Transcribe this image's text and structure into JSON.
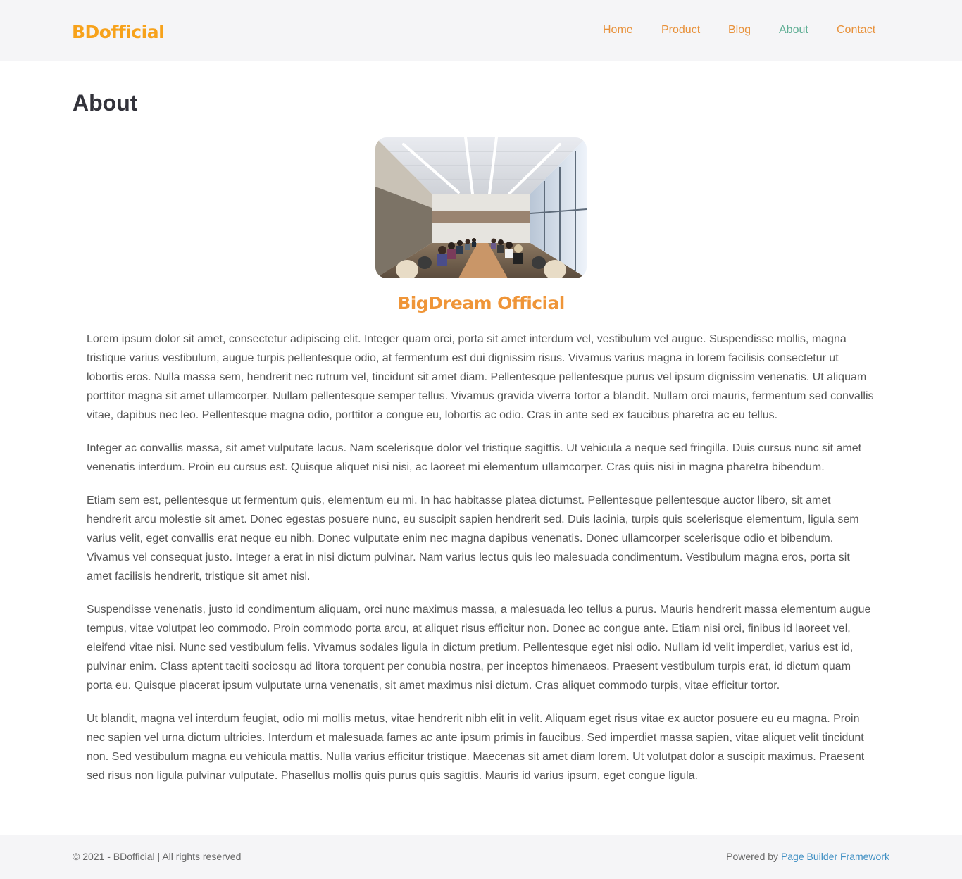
{
  "header": {
    "logo": "BDofficial",
    "nav": [
      {
        "label": "Home",
        "active": false
      },
      {
        "label": "Product",
        "active": false
      },
      {
        "label": "Blog",
        "active": false
      },
      {
        "label": "About",
        "active": true
      },
      {
        "label": "Contact",
        "active": false
      }
    ]
  },
  "main": {
    "title": "About",
    "hero_image": "conference-room-meeting-photo",
    "org_name": "BigDream Official",
    "paragraphs": [
      "Lorem ipsum dolor sit amet, consectetur adipiscing elit. Integer quam orci, porta sit amet interdum vel, vestibulum vel augue. Suspendisse mollis, magna tristique varius vestibulum, augue turpis pellentesque odio, at fermentum est dui dignissim risus. Vivamus varius magna in lorem facilisis consectetur ut lobortis eros. Nulla massa sem, hendrerit nec rutrum vel, tincidunt sit amet diam. Pellentesque pellentesque purus vel ipsum dignissim venenatis. Ut aliquam porttitor magna sit amet ullamcorper. Nullam pellentesque semper tellus. Vivamus gravida viverra tortor a blandit. Nullam orci mauris, fermentum sed convallis vitae, dapibus nec leo. Pellentesque magna odio, porttitor a congue eu, lobortis ac odio. Cras in ante sed ex faucibus pharetra ac eu tellus.",
      "Integer ac convallis massa, sit amet vulputate lacus. Nam scelerisque dolor vel tristique sagittis. Ut vehicula a neque sed fringilla. Duis cursus nunc sit amet venenatis interdum. Proin eu cursus est. Quisque aliquet nisi nisi, ac laoreet mi elementum ullamcorper. Cras quis nisi in magna pharetra bibendum.",
      "Etiam sem est, pellentesque ut fermentum quis, elementum eu mi. In hac habitasse platea dictumst. Pellentesque pellentesque auctor libero, sit amet hendrerit arcu molestie sit amet. Donec egestas posuere nunc, eu suscipit sapien hendrerit sed. Duis lacinia, turpis quis scelerisque elementum, ligula sem varius velit, eget convallis erat neque eu nibh. Donec vulputate enim nec magna dapibus venenatis. Donec ullamcorper scelerisque odio et bibendum. Vivamus vel consequat justo. Integer a erat in nisi dictum pulvinar. Nam varius lectus quis leo malesuada condimentum. Vestibulum magna eros, porta sit amet facilisis hendrerit, tristique sit amet nisl.",
      "Suspendisse venenatis, justo id condimentum aliquam, orci nunc maximus massa, a malesuada leo tellus a purus. Mauris hendrerit massa elementum augue tempus, vitae volutpat leo commodo. Proin commodo porta arcu, at aliquet risus efficitur non. Donec ac congue ante. Etiam nisi orci, finibus id laoreet vel, eleifend vitae nisi. Nunc sed vestibulum felis. Vivamus sodales ligula in dictum pretium. Pellentesque eget nisi odio. Nullam id velit imperdiet, varius est id, pulvinar enim. Class aptent taciti sociosqu ad litora torquent per conubia nostra, per inceptos himenaeos. Praesent vestibulum turpis erat, id dictum quam porta eu. Quisque placerat ipsum vulputate urna venenatis, sit amet maximus nisi dictum. Cras aliquet commodo turpis, vitae efficitur tortor.",
      "Ut blandit, magna vel interdum feugiat, odio mi mollis metus, vitae hendrerit nibh elit in velit. Aliquam eget risus vitae ex auctor posuere eu eu magna. Proin nec sapien vel urna dictum ultricies. Interdum et malesuada fames ac ante ipsum primis in faucibus. Sed imperdiet massa sapien, vitae aliquet velit tincidunt non. Sed vestibulum magna eu vehicula mattis. Nulla varius efficitur tristique. Maecenas sit amet diam lorem. Ut volutpat dolor a suscipit maximus. Praesent sed risus non ligula pulvinar vulputate. Phasellus mollis quis purus quis sagittis. Mauris id varius ipsum, eget congue ligula."
    ]
  },
  "footer": {
    "copyright": "© 2021 - BDofficial | All rights reserved",
    "powered_prefix": "Powered by",
    "powered_link": "Page Builder Framework"
  },
  "colors": {
    "logo": "#f7a21b",
    "nav": "#e8913a",
    "nav_active": "#5fae94",
    "org_name": "#ef9538",
    "link": "#3f8fc3",
    "header_bg": "#f5f5f7"
  }
}
